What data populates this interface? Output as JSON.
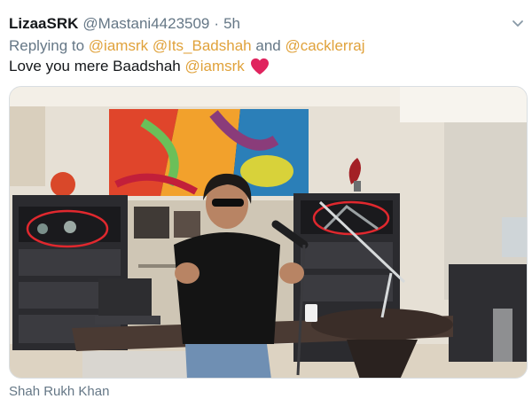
{
  "tweet": {
    "display_name": "LizaaSRK",
    "handle": "@Mastani4423509",
    "separator": "·",
    "time": "5h",
    "reply_prefix": "Replying to",
    "reply_mentions": [
      "@iamsrk",
      "@Its_Badshah",
      "@cacklerraj"
    ],
    "reply_and": "and",
    "text": "Love you mere Baadshah",
    "text_mention": "@iamsrk",
    "heart_icon": "red-heart-icon",
    "more_icon": "chevron-down-icon"
  },
  "media": {
    "description_icon": "photo"
  },
  "caption": "Shah Rukh Khan",
  "colors": {
    "mention": "#e0a23b",
    "muted": "#657786",
    "heart": "#e0245e",
    "annotation_circle": "#e0282e"
  }
}
